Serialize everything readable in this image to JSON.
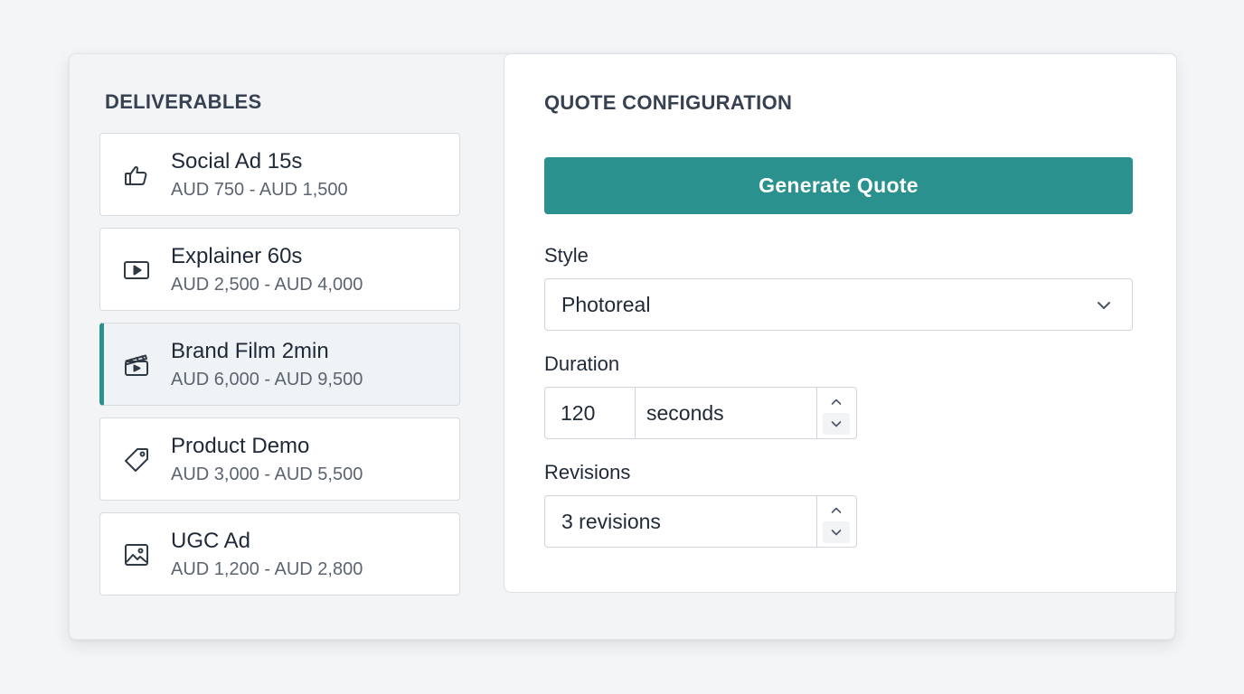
{
  "deliverables": {
    "heading": "DELIVERABLES",
    "items": [
      {
        "title": "Social Ad 15s",
        "range": "AUD 750 - AUD 1,500",
        "icon": "thumbs-up-icon",
        "active": false
      },
      {
        "title": "Explainer 60s",
        "range": "AUD 2,500 - AUD 4,000",
        "icon": "play-icon",
        "active": false
      },
      {
        "title": "Brand Film 2min",
        "range": "AUD 6,000 - AUD 9,500",
        "icon": "clapperboard-icon",
        "active": true
      },
      {
        "title": "Product Demo",
        "range": "AUD 3,000 - AUD 5,500",
        "icon": "tag-icon",
        "active": false
      },
      {
        "title": "UGC Ad",
        "range": "AUD 1,200 - AUD 2,800",
        "icon": "image-icon",
        "active": false
      }
    ]
  },
  "quote": {
    "heading": "QUOTE CONFIGURATION",
    "generate_label": "Generate Quote",
    "style_label": "Style",
    "style_value": "Photoreal",
    "duration_label": "Duration",
    "duration_value": "120",
    "duration_unit": "seconds",
    "revisions_label": "Revisions",
    "revisions_value": "3 revisions"
  },
  "colors": {
    "accent": "#2a918e",
    "background": "#f3f5f7",
    "panel": "#ffffff"
  }
}
